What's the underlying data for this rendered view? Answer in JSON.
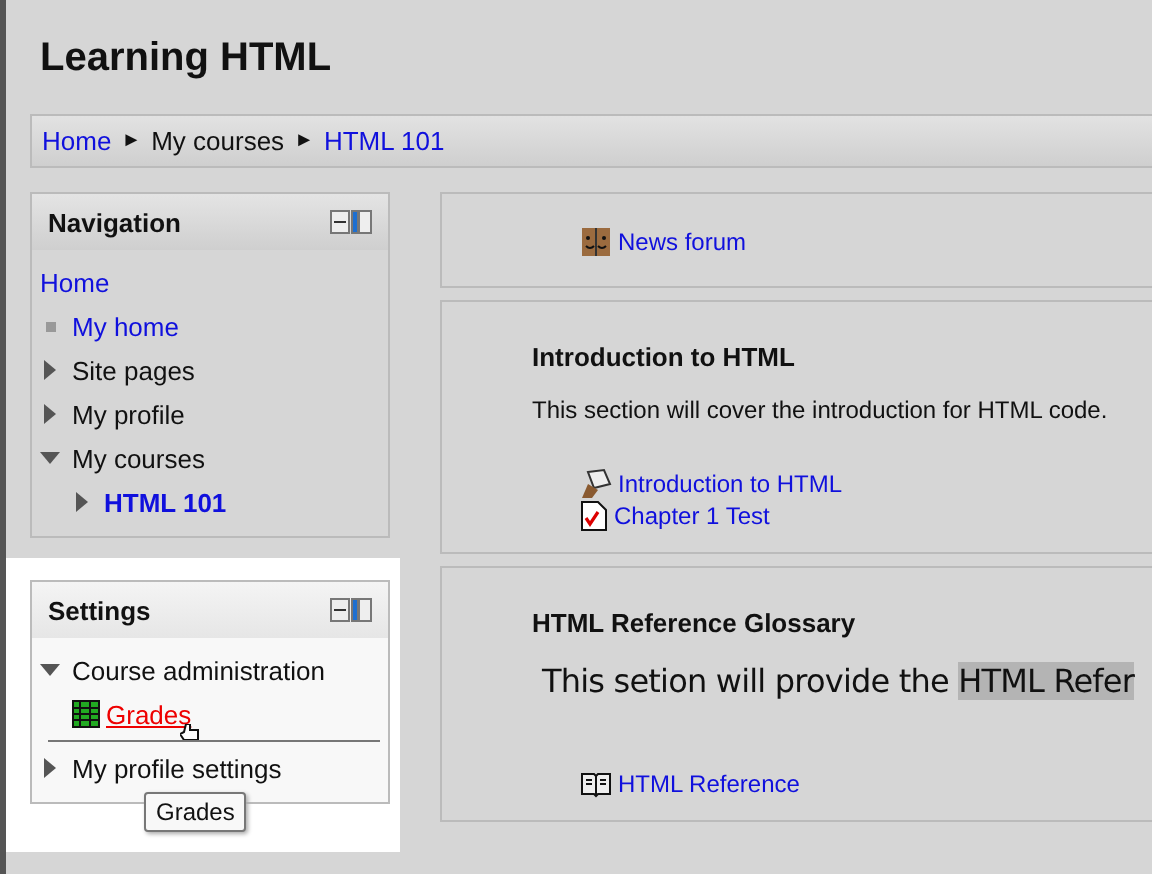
{
  "page_title": "Learning HTML",
  "breadcrumb": [
    {
      "label": "Home",
      "kind": "link"
    },
    {
      "label": "My courses",
      "kind": "text"
    },
    {
      "label": "HTML 101",
      "kind": "link"
    }
  ],
  "breadcrumb_separator": "►",
  "navigation": {
    "title": "Navigation",
    "items": [
      {
        "label": "Home",
        "kind": "root",
        "children": [
          {
            "label": "My home",
            "kind": "leaf"
          },
          {
            "label": "Site pages",
            "kind": "branch",
            "expanded": false
          },
          {
            "label": "My profile",
            "kind": "branch",
            "expanded": false
          },
          {
            "label": "My courses",
            "kind": "branch",
            "expanded": true,
            "children": [
              {
                "label": "HTML 101",
                "kind": "course",
                "expanded": false
              }
            ]
          }
        ]
      }
    ]
  },
  "settings": {
    "title": "Settings",
    "items": [
      {
        "label": "Course administration",
        "expanded": true,
        "children": [
          {
            "label": "Grades",
            "hovered": true
          }
        ]
      },
      {
        "label": "My profile settings",
        "expanded": false
      }
    ],
    "tooltip": "Grades"
  },
  "sections": [
    {
      "activities": [
        {
          "label": "News forum",
          "kind": "forum"
        }
      ]
    },
    {
      "title": "Introduction to HTML",
      "summary": "This section will cover the introduction for HTML code.",
      "activities": [
        {
          "label": "Introduction to HTML",
          "kind": "resource"
        },
        {
          "label": "Chapter 1 Test",
          "kind": "quiz"
        }
      ]
    },
    {
      "title": "HTML Reference Glossary",
      "summary": "This setion will provide the ",
      "highlight": "HTML Refer",
      "activities": [
        {
          "label": "HTML Reference",
          "kind": "glossary"
        }
      ]
    }
  ]
}
